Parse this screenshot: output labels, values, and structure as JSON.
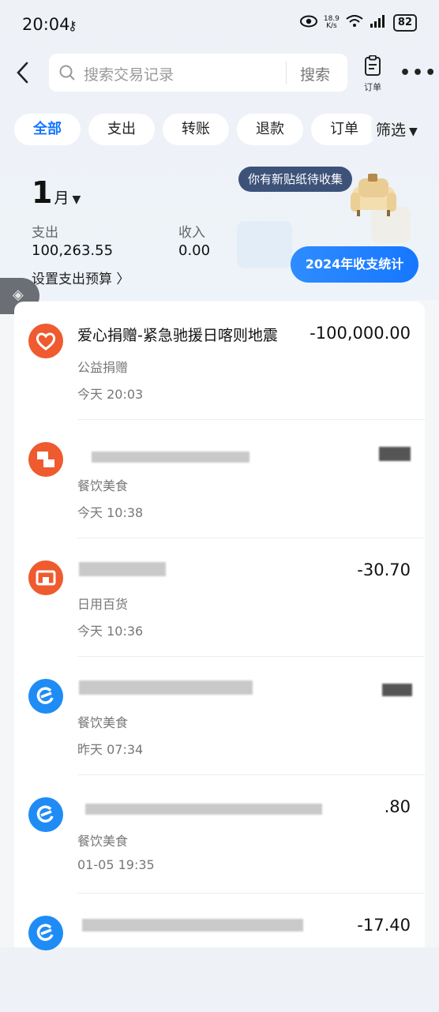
{
  "status": {
    "time": "20:04",
    "net_speed_value": "18.9",
    "net_speed_unit": "K/s",
    "battery": "82"
  },
  "header": {
    "search_placeholder": "搜索交易记录",
    "search_button": "搜索",
    "order_label": "订单"
  },
  "chips": [
    "全部",
    "支出",
    "转账",
    "退款",
    "订单"
  ],
  "filter_label": "筛选",
  "sticker_tip": "你有新贴纸待收集",
  "summary": {
    "month_number": "1",
    "month_unit": "月",
    "expense_label": "支出",
    "expense_value": "100,263.55",
    "income_label": "收入",
    "income_value": "0.00",
    "budget_link": "设置支出预算 〉",
    "stats_button": "2024年收支统计"
  },
  "transactions": [
    {
      "title": "爱心捐赠-紧急驰援日喀则地震",
      "amount": "-100,000.00",
      "category": "公益捐赠",
      "time": "今天 20:03",
      "icon": "charity-heart-icon",
      "color": "#ef5a2f"
    },
    {
      "title": "",
      "amount": "",
      "category": "餐饮美食",
      "time": "今天 10:38",
      "icon": "food-store-icon",
      "color": "#ef5a2f"
    },
    {
      "title": "",
      "amount": "-30.70",
      "category": "日用百货",
      "time": "今天 10:36",
      "icon": "shop-icon",
      "color": "#ef5a2f"
    },
    {
      "title": "",
      "amount": "",
      "category": "餐饮美食",
      "time": "昨天 07:34",
      "icon": "eleme-icon",
      "color": "#1f8cf5"
    },
    {
      "title": "",
      "amount": ".80",
      "category": "餐饮美食",
      "time": "01-05 19:35",
      "icon": "eleme-icon",
      "color": "#1f8cf5"
    },
    {
      "title": "",
      "amount": "-17.40",
      "category": "",
      "time": "",
      "icon": "eleme-icon",
      "color": "#1f8cf5"
    }
  ]
}
